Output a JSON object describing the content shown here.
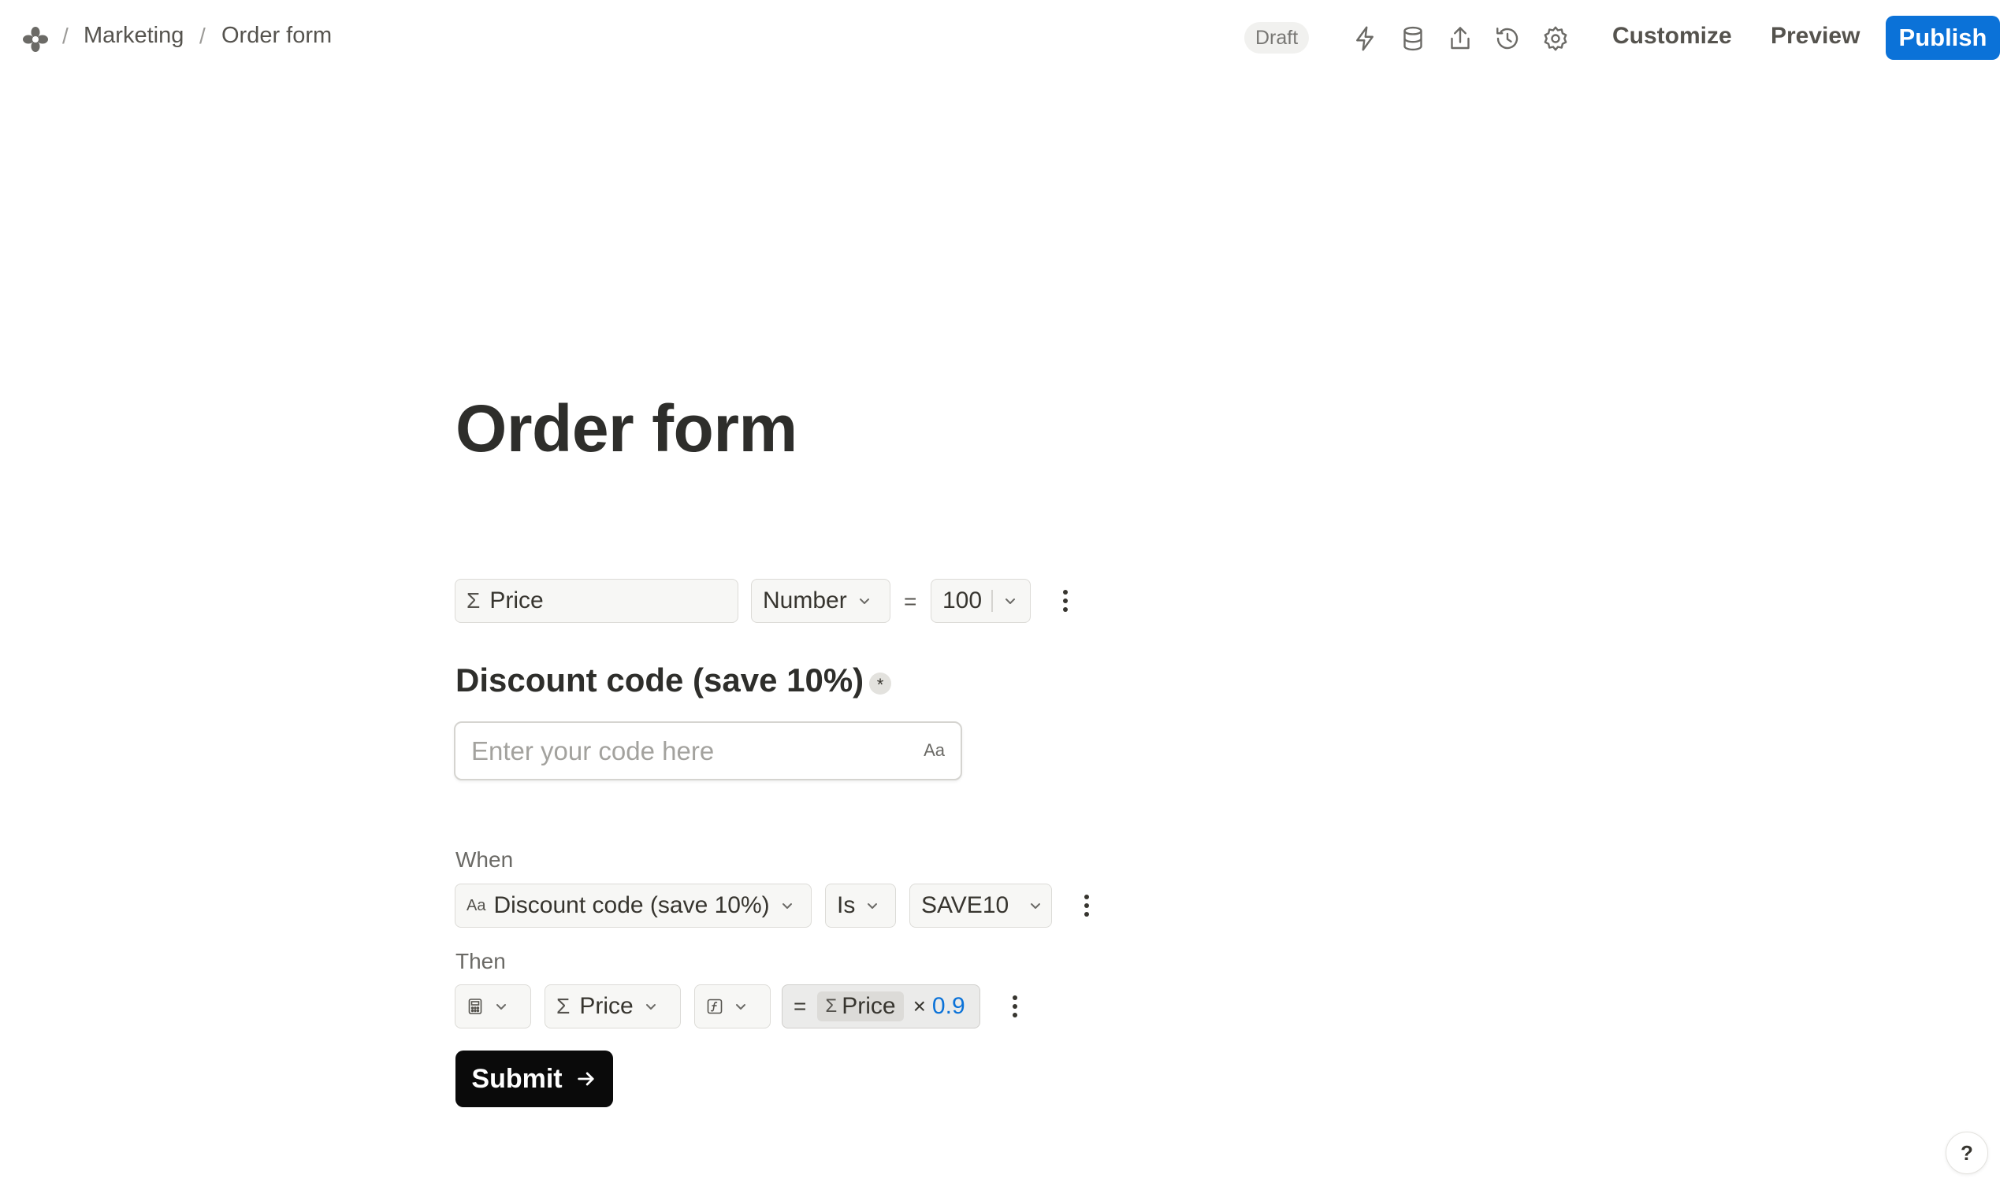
{
  "breadcrumb": {
    "workspace": "Marketing",
    "page": "Order form",
    "separator": "/"
  },
  "status_badge": "Draft",
  "toolbar": {
    "icons": [
      "lightning-icon",
      "database-icon",
      "share-icon",
      "history-icon",
      "gear-icon"
    ],
    "customize_label": "Customize",
    "preview_label": "Preview",
    "publish_label": "Publish"
  },
  "page_title": "Order form",
  "variable_row": {
    "field": "Price",
    "type": "Number",
    "operator": "=",
    "value": "100"
  },
  "question": {
    "label": "Discount code (save 10%)",
    "required_marker": "*",
    "placeholder": "Enter your code here",
    "value": "",
    "type_indicator": "Aa"
  },
  "logic": {
    "when_label": "When",
    "when_field": "Discount code (save 10%)",
    "when_field_icon": "Aa",
    "when_operator": "Is",
    "when_value": "SAVE10",
    "then_label": "Then",
    "then_field": "Price",
    "formula": {
      "equals": "=",
      "token": "Price",
      "op": "×",
      "number": "0.9"
    }
  },
  "submit_label": "Submit",
  "help_label": "?",
  "colors": {
    "accent": "#0b72d8",
    "submit": "#0a0a0a",
    "text": "#37352f"
  }
}
